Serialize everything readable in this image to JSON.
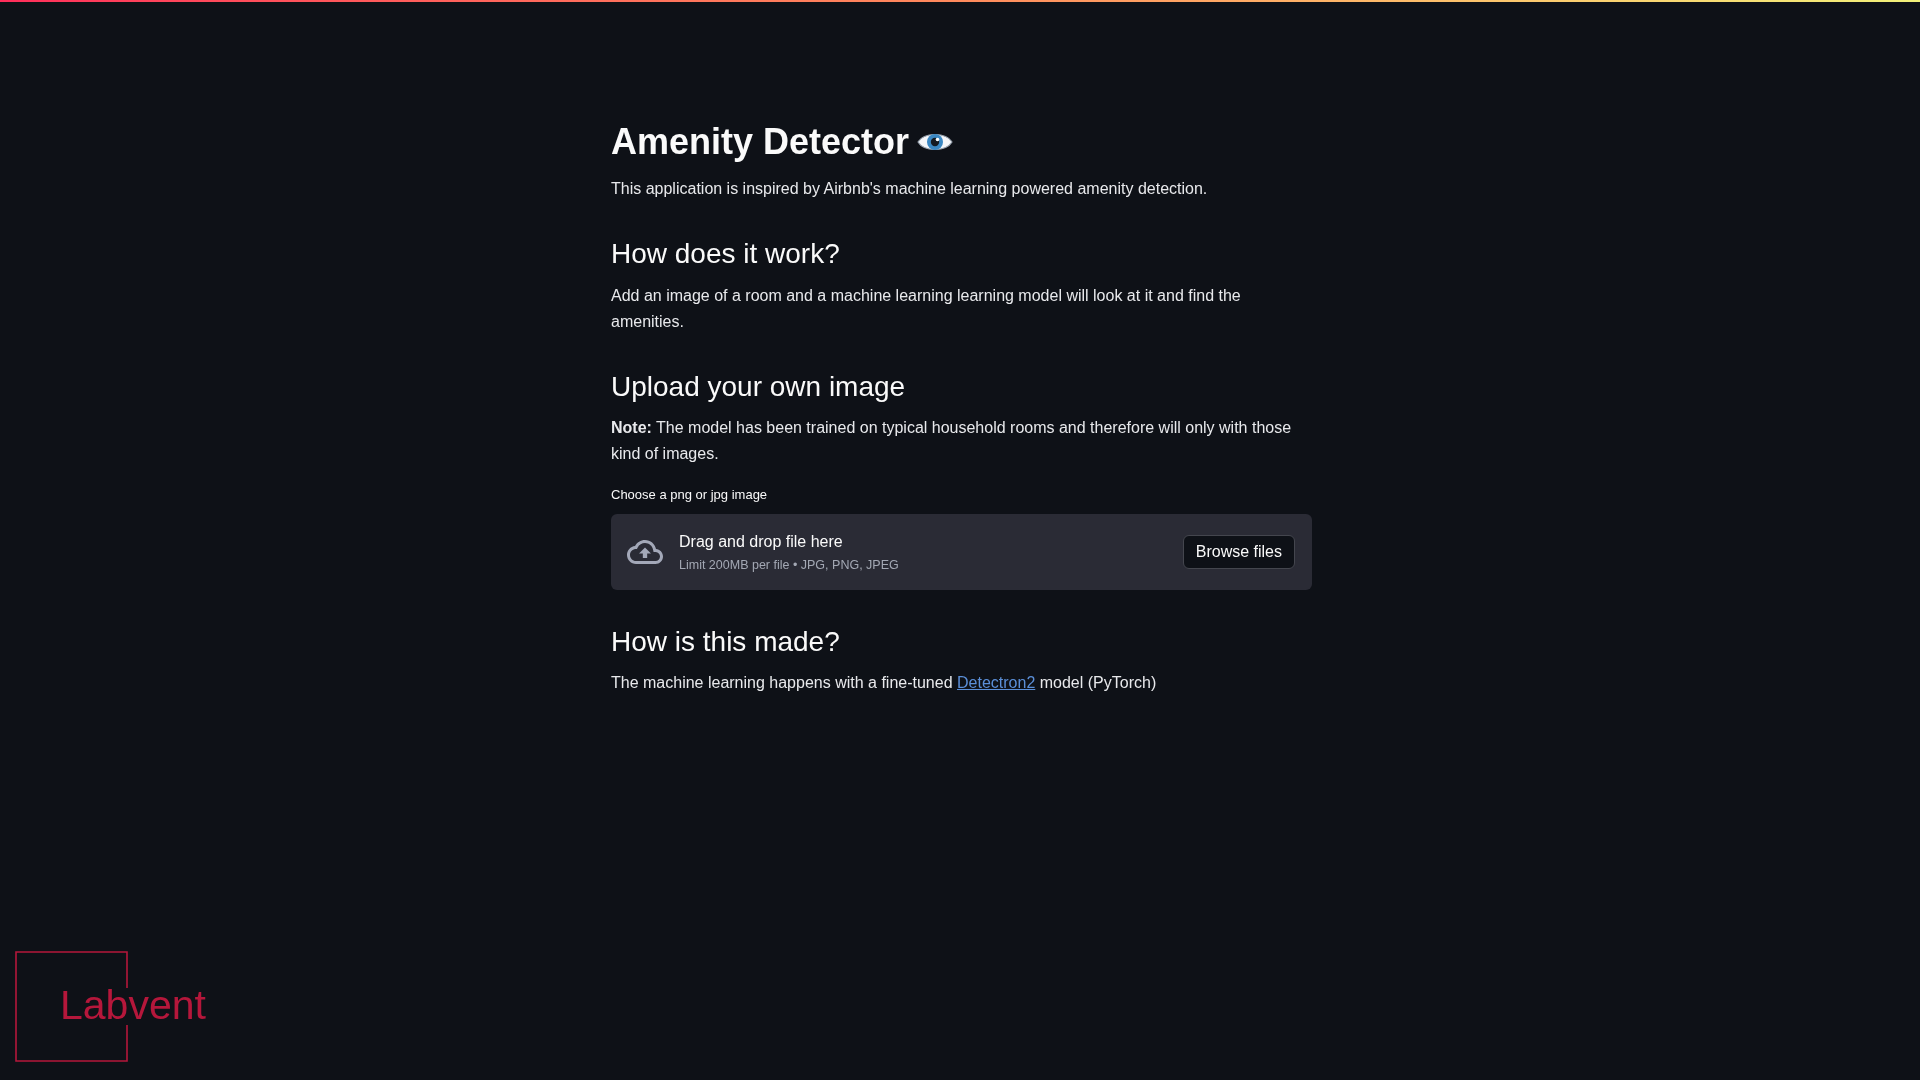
{
  "header": {
    "title": "Amenity Detector",
    "intro": "This application is inspired by Airbnb's machine learning powered amenity detection."
  },
  "sections": [
    {
      "kind": "text",
      "heading": "How does it work?",
      "body": "Add an image of a room and a machine learning learning model will look at it and find the amenities."
    },
    {
      "kind": "upload",
      "heading": "Upload your own image",
      "note": "**Note:** The model has been trained on typical household rooms and therefore will only with those kind of images.",
      "uploader": {
        "label": "Choose a png or jpg image",
        "drop_text": "Drag and drop file here",
        "limit_text": "Limit 200MB per file • JPG, PNG, JPEG",
        "button": "Browse files"
      }
    },
    {
      "kind": "text_with_link",
      "heading": "How is this made?",
      "before": "The machine learning happens with a fine-tuned",
      "link": "Detectron2",
      "after": "model (PyTorch)"
    }
  ],
  "logo": {
    "text": "Labvent"
  }
}
